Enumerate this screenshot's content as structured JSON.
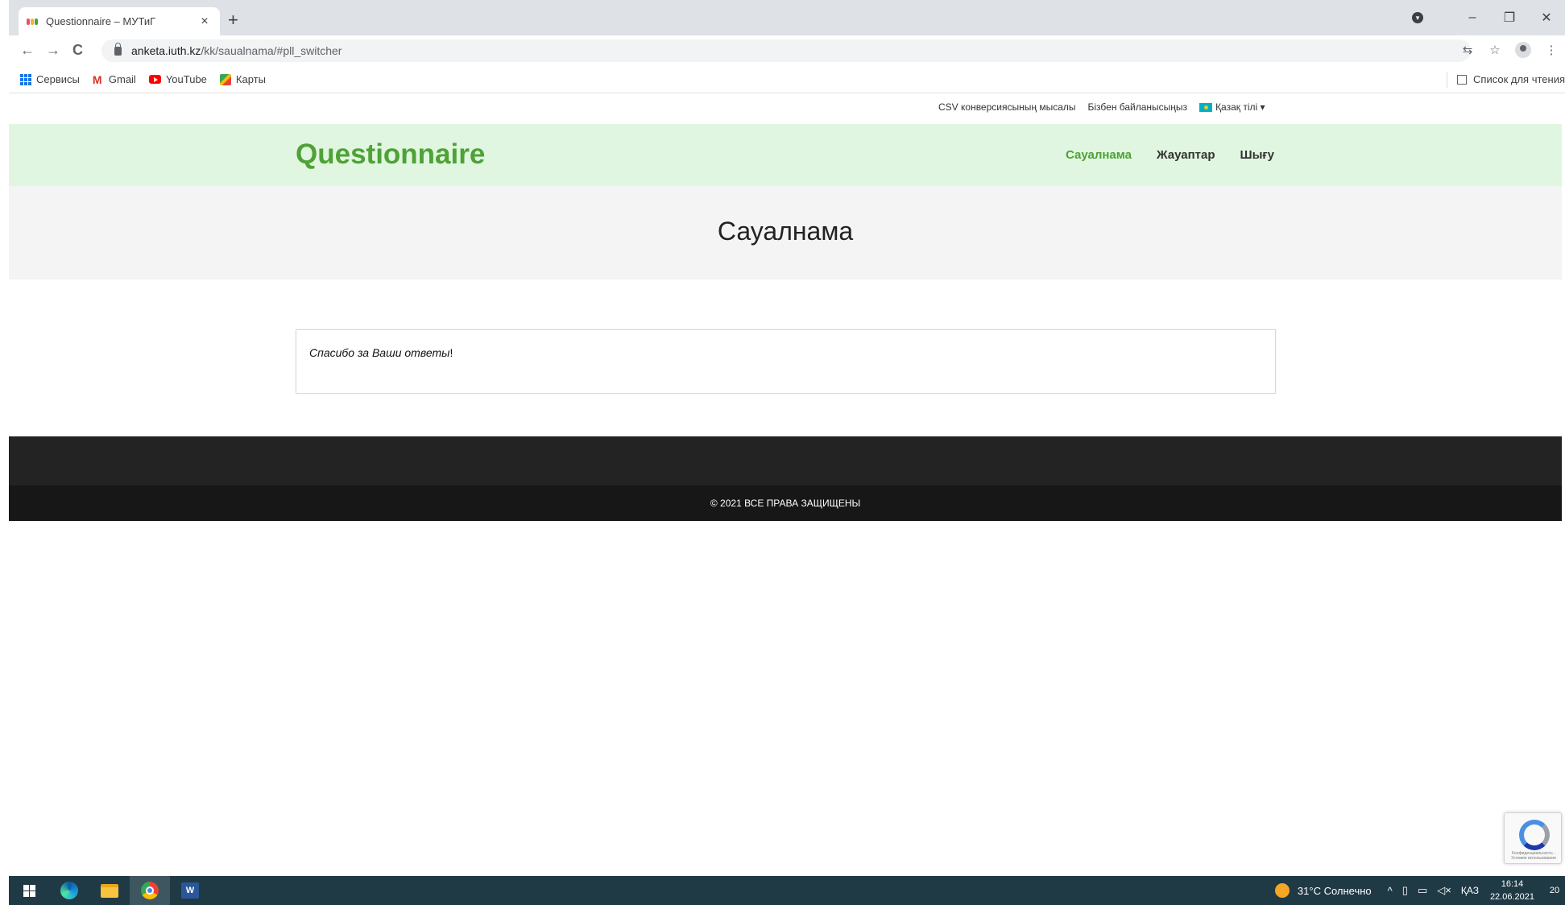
{
  "browser": {
    "tab_title": "Questionnaire – МУТиГ",
    "tab_close": "×",
    "new_tab": "+",
    "url_host": "anketa.iuth.kz",
    "url_path": "/kk/saualnama/#pll_switcher",
    "back": "←",
    "forward": "→",
    "reload": "C",
    "win_minimize": "–",
    "win_restore": "❐",
    "win_close": "✕",
    "translate_icon": "⇆",
    "star_icon": "☆",
    "menu_icon": "⋮"
  },
  "bookmarks": {
    "apps": "Сервисы",
    "gmail": "Gmail",
    "youtube": "YouTube",
    "maps": "Карты",
    "reading_list": "Список для чтения"
  },
  "site": {
    "topbar": {
      "csv_link": "CSV конверсиясының мысалы",
      "contact_link": "Бізбен байланысыңыз",
      "language": "Қазақ тілі",
      "language_chevron": "▾"
    },
    "logo": "Questionnaire",
    "nav": {
      "survey": "Сауалнама",
      "answers": "Жауаптар",
      "logout": "Шығу"
    },
    "page_title": "Сауалнама",
    "message_italic": "Спасибо за Ваши ответы",
    "message_tail": "!",
    "footer_copyright": "© 2021 ВСЕ ПРАВА ЗАЩИЩЕНЫ"
  },
  "recaptcha": {
    "text": "Конфиденциальность - Условия использования"
  },
  "taskbar": {
    "word_label": "W",
    "weather": "31°C Солнечно",
    "tray_chevron": "^",
    "language": "ҚАЗ",
    "time": "16:14",
    "date": "22.06.2021",
    "notifications": "20"
  }
}
